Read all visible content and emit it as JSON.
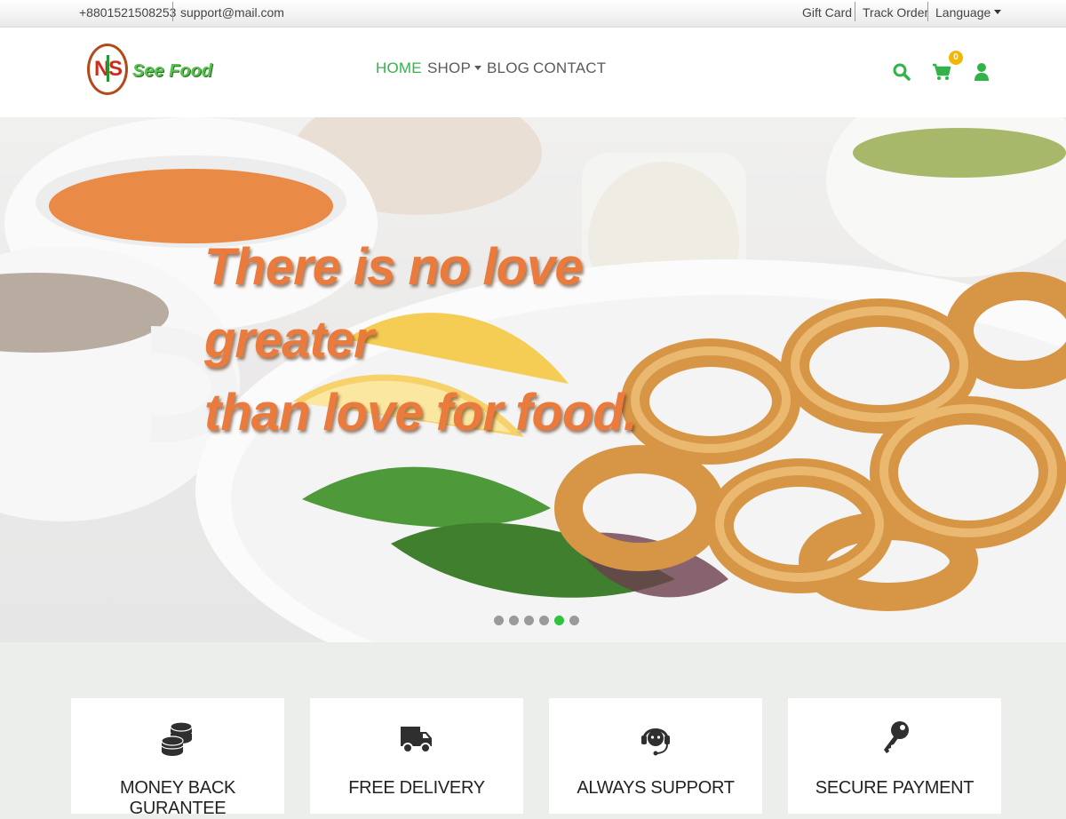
{
  "topbar": {
    "phone": "+8801521508253",
    "email": "support@mail.com",
    "gift_card": "Gift Card",
    "track_order": "Track Order",
    "language": "Language"
  },
  "brand": {
    "logo_n": "N",
    "logo_s": "S",
    "name": "See Food"
  },
  "nav": {
    "home": "HOME",
    "shop": "SHOP",
    "blog": "BLOG",
    "contact": "CONTACT"
  },
  "cart": {
    "count": "0"
  },
  "hero": {
    "quote_line1": "There is no love greater",
    "quote_line2": "than love for food.",
    "slides_total": 6,
    "active_slide": 5
  },
  "features": [
    {
      "label": "MONEY BACK GURANTEE",
      "icon": "coins-icon"
    },
    {
      "label": "FREE DELIVERY",
      "icon": "truck-icon"
    },
    {
      "label": "ALWAYS SUPPORT",
      "icon": "headset-icon"
    },
    {
      "label": "SECURE PAYMENT",
      "icon": "key-icon"
    }
  ],
  "colors": {
    "accent_green": "#32b34a",
    "quote_orange": "#ea7b3c",
    "badge_yellow": "#f2b705"
  }
}
